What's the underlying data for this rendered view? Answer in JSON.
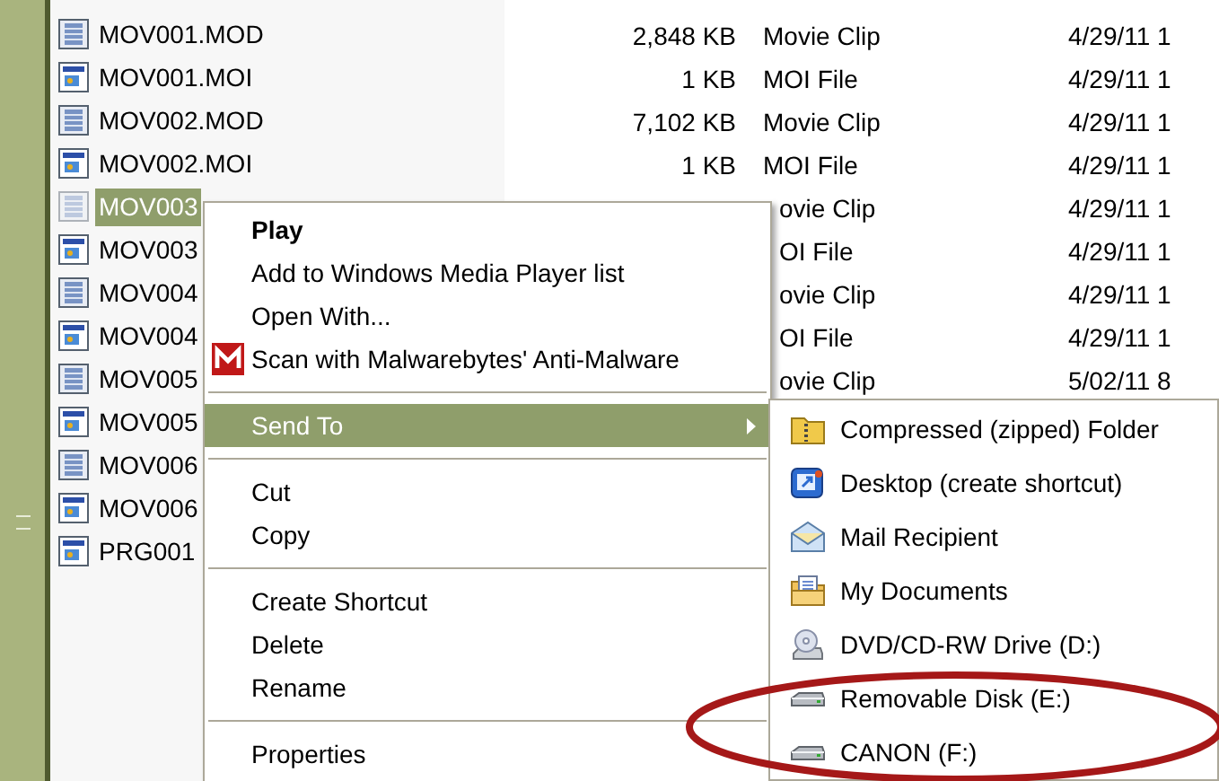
{
  "files": [
    {
      "kind": "mod",
      "name": "MOV001.MOD",
      "size": "2,848 KB",
      "type": "Movie Clip",
      "date": "4/29/11 1",
      "selected": false
    },
    {
      "kind": "moi",
      "name": "MOV001.MOI",
      "size": "1 KB",
      "type": "MOI File",
      "date": "4/29/11 1",
      "selected": false
    },
    {
      "kind": "mod",
      "name": "MOV002.MOD",
      "size": "7,102 KB",
      "type": "Movie Clip",
      "date": "4/29/11 1",
      "selected": false
    },
    {
      "kind": "moi",
      "name": "MOV002.MOI",
      "size": "1 KB",
      "type": "MOI File",
      "date": "4/29/11 1",
      "selected": false
    },
    {
      "kind": "mod",
      "name": "MOV003",
      "type": "ovie Clip",
      "date": "4/29/11 1",
      "selected": true
    },
    {
      "kind": "moi",
      "name": "MOV003",
      "type": "OI File",
      "date": "4/29/11 1",
      "selected": false
    },
    {
      "kind": "mod",
      "name": "MOV004",
      "type": "ovie Clip",
      "date": "4/29/11 1",
      "selected": false
    },
    {
      "kind": "moi",
      "name": "MOV004",
      "type": "OI File",
      "date": "4/29/11 1",
      "selected": false
    },
    {
      "kind": "mod",
      "name": "MOV005",
      "type": "ovie Clip",
      "date": "5/02/11 8",
      "selected": false
    },
    {
      "kind": "moi",
      "name": "MOV005",
      "selected": false
    },
    {
      "kind": "mod",
      "name": "MOV006",
      "selected": false
    },
    {
      "kind": "moi",
      "name": "MOV006",
      "selected": false
    },
    {
      "kind": "moi",
      "name": "PRG001",
      "selected": false
    }
  ],
  "context_menu": [
    {
      "kind": "item",
      "label": "Play",
      "bold": true,
      "selected": false
    },
    {
      "kind": "item",
      "label": "Add to Windows Media Player list",
      "selected": false
    },
    {
      "kind": "item",
      "label": "Open With...",
      "selected": false
    },
    {
      "kind": "scan",
      "label": "Scan with Malwarebytes' Anti-Malware",
      "selected": false
    },
    {
      "kind": "separator"
    },
    {
      "kind": "submenu",
      "label": "Send To",
      "selected": true
    },
    {
      "kind": "separator"
    },
    {
      "kind": "item",
      "label": "Cut",
      "selected": false
    },
    {
      "kind": "item",
      "label": "Copy",
      "selected": false
    },
    {
      "kind": "separator"
    },
    {
      "kind": "item",
      "label": "Create Shortcut",
      "selected": false
    },
    {
      "kind": "item",
      "label": "Delete",
      "selected": false
    },
    {
      "kind": "item",
      "label": "Rename",
      "selected": false
    },
    {
      "kind": "separator"
    },
    {
      "kind": "item",
      "label": "Properties",
      "selected": false
    }
  ],
  "send_to_menu": [
    {
      "kind": "zip",
      "label": "Compressed (zipped) Folder"
    },
    {
      "kind": "desktop",
      "label": "Desktop (create shortcut)"
    },
    {
      "kind": "mail",
      "label": "Mail Recipient"
    },
    {
      "kind": "documents",
      "label": "My Documents"
    },
    {
      "kind": "dvd",
      "label": "DVD/CD-RW Drive (D:)"
    },
    {
      "kind": "drive",
      "label": "Removable Disk (E:)"
    },
    {
      "kind": "drive",
      "label": "CANON (F:)"
    }
  ]
}
